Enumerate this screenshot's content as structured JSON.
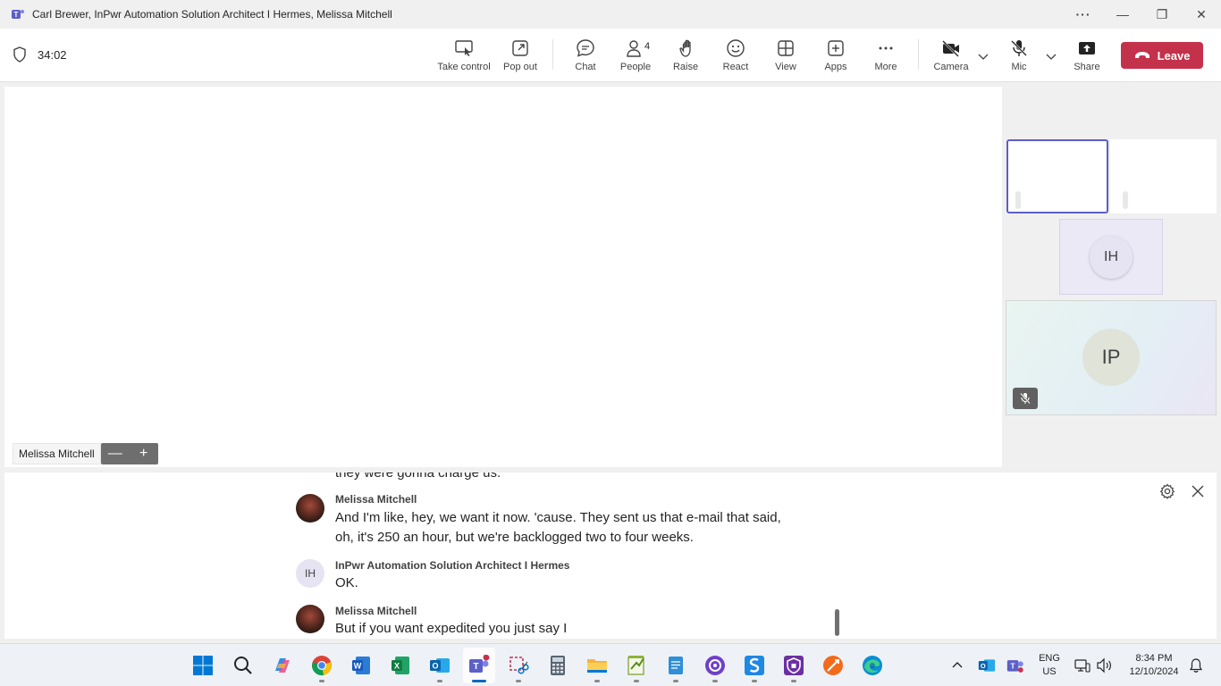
{
  "window": {
    "title": "Carl Brewer, InPwr Automation Solution Architect I Hermes, Melissa Mitchell",
    "controls": {
      "more": "···",
      "minimize": "—",
      "restore": "❐",
      "close": "✕"
    }
  },
  "toolbar": {
    "timer": "34:02",
    "buttons": [
      {
        "label": "Take control",
        "icon": "take-control-icon"
      },
      {
        "label": "Pop out",
        "icon": "pop-out-icon"
      },
      {
        "label": "Chat",
        "icon": "chat-icon"
      },
      {
        "label": "People",
        "icon": "people-icon"
      },
      {
        "label": "Raise",
        "icon": "raise-hand-icon"
      },
      {
        "label": "React",
        "icon": "react-icon"
      },
      {
        "label": "View",
        "icon": "view-icon"
      },
      {
        "label": "Apps",
        "icon": "apps-icon"
      },
      {
        "label": "More",
        "icon": "more-icon"
      },
      {
        "label": "Camera",
        "icon": "camera-off-icon"
      },
      {
        "label": "Mic",
        "icon": "mic-off-icon"
      },
      {
        "label": "Share",
        "icon": "share-icon"
      }
    ],
    "people_count": "4",
    "leave_label": "Leave",
    "leave_color": "#c4314b"
  },
  "stage": {
    "speaker_name": "Melissa Mitchell",
    "zoom_out": "—",
    "zoom_in": "+"
  },
  "gallery": {
    "tile_ih_initials": "IH",
    "tile_ip_initials": "IP",
    "active_border_color": "#5b5fc7"
  },
  "captions": {
    "partial_line": "they were gonna charge us.",
    "entries": [
      {
        "speaker": "Melissa Mitchell",
        "lines": [
          "And I'm like, hey, we want it now. 'cause. They sent us that e-mail that said,",
          "oh, it's 250 an hour, but we're backlogged two to four weeks."
        ]
      },
      {
        "speaker": "InPwr Automation Solution Architect I Hermes",
        "initials": "IH",
        "lines": [
          "OK."
        ]
      },
      {
        "speaker": "Melissa Mitchell",
        "lines": [
          "But if you want expedited you just say I"
        ]
      }
    ]
  },
  "taskbar": {
    "apps": [
      "start",
      "search",
      "copilot",
      "chrome",
      "word",
      "excel",
      "outlook",
      "teams",
      "snipping-tool",
      "calculator",
      "file-explorer",
      "notepad-plus",
      "notepad",
      "github-desktop",
      "app-s",
      "app-shield",
      "app-orange",
      "edge"
    ],
    "tray": {
      "language": "ENG",
      "region": "US",
      "time": "8:34 PM",
      "date": "12/10/2024"
    }
  }
}
